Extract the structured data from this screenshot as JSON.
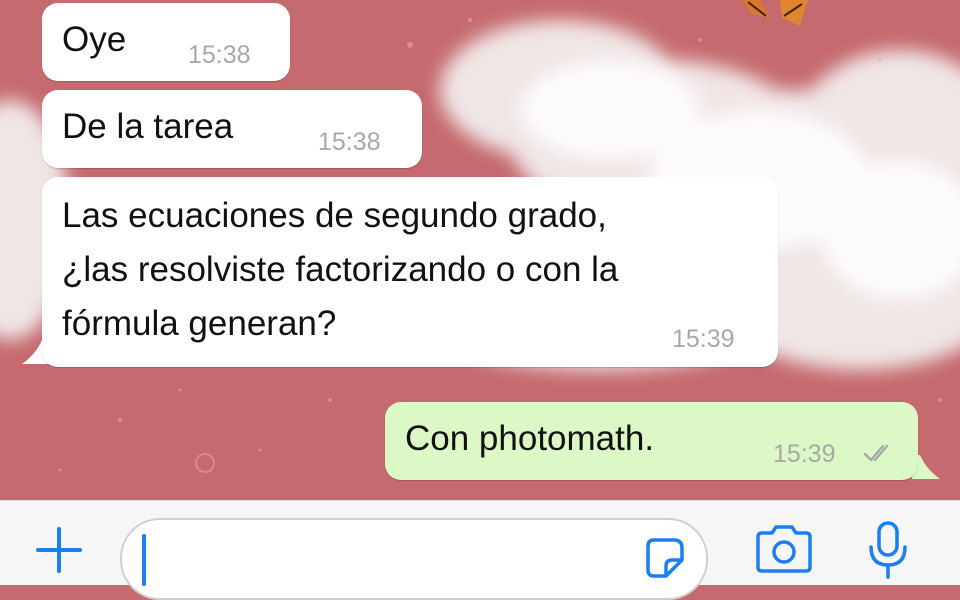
{
  "chat": {
    "messages": [
      {
        "direction": "incoming",
        "lines": [
          "Oye"
        ],
        "time": "15:38"
      },
      {
        "direction": "incoming",
        "lines": [
          "De la tarea"
        ],
        "time": "15:38"
      },
      {
        "direction": "incoming",
        "lines": [
          "Las ecuaciones de segundo grado,",
          "¿las resolviste factorizando o con la",
          "fórmula generan?"
        ],
        "time": "15:39"
      },
      {
        "direction": "outgoing",
        "lines": [
          "Con photomath."
        ],
        "time": "15:39",
        "status": "read-ticks"
      }
    ]
  },
  "composer": {
    "input_value": "",
    "icons": [
      "plus-icon",
      "sticker-icon",
      "camera-icon",
      "microphone-icon"
    ]
  },
  "colors": {
    "wallpaper": "#c56a6e",
    "incoming_bubble": "#ffffff",
    "outgoing_bubble": "#dcf8c6",
    "accent": "#1a7ff0"
  }
}
